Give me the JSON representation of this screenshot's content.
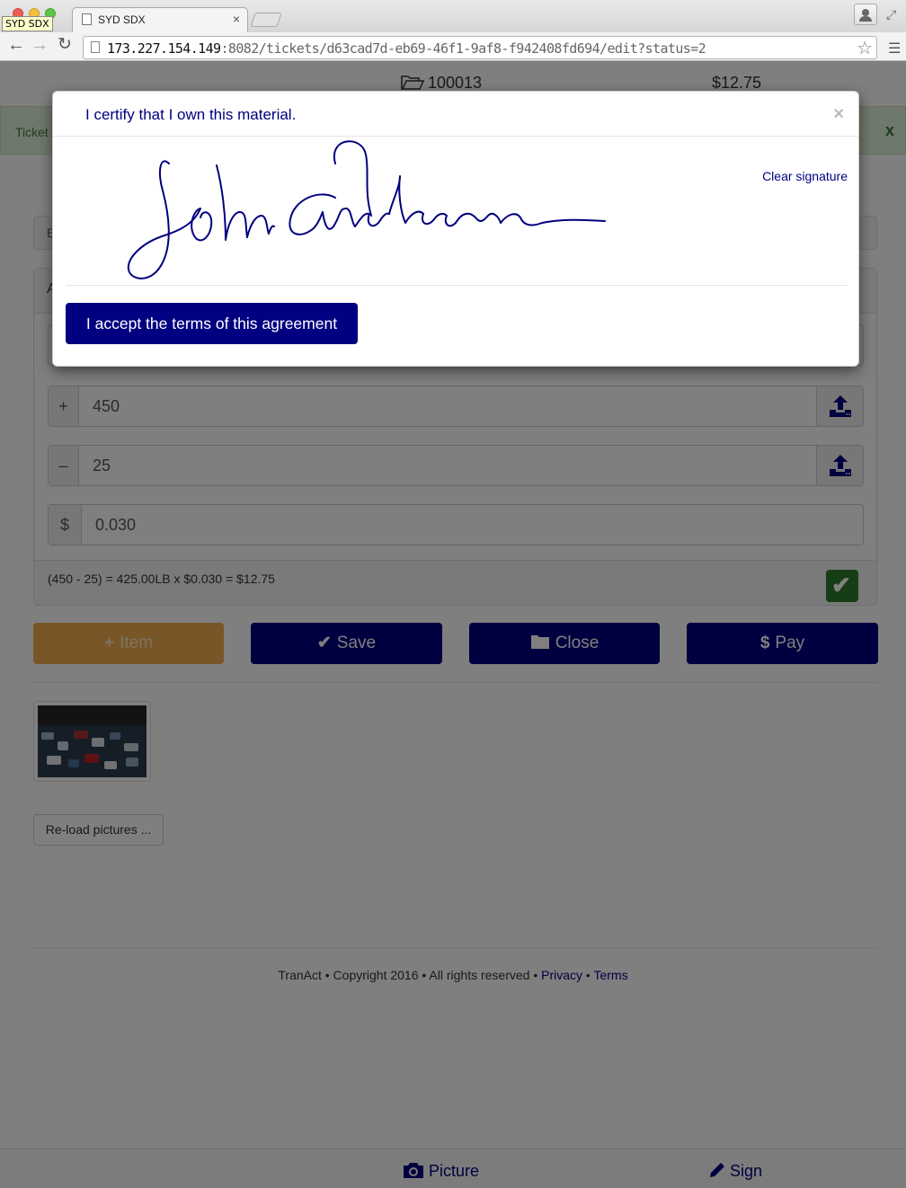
{
  "browser": {
    "tooltip": "SYD SDX",
    "tab_title": "SYD SDX",
    "tab_close": "×",
    "url_host": "173.227.154.149",
    "url_rest": ":8082/tickets/d63cad7d-eb69-46f1-9af8-f942408fd694/edit?status=2",
    "icons": {
      "back": "arrow-left-icon",
      "forward": "arrow-right-icon",
      "reload": "reload-icon",
      "bookmark": "star-icon",
      "menu": "hamburger-menu-icon"
    }
  },
  "ticket": {
    "number": "100013",
    "total": "$12.75",
    "alert_text": "Ticket",
    "alert_close": "x",
    "panel_label": "E",
    "section_label": "A"
  },
  "line_item": {
    "gross_sign": "+",
    "gross": "450",
    "tare_sign": "–",
    "tare": "25",
    "price_sign": "$",
    "price": "0.030",
    "calculation": "(450 - 25) = 425.00LB x $0.030 = $12.75"
  },
  "actions": {
    "item": "Item",
    "save": "Save",
    "close": "Close",
    "pay": "Pay"
  },
  "reload_pictures": "Re-load pictures ...",
  "footer": {
    "prefix": "TranAct • Copyright 2016 • All rights reserved • ",
    "privacy": "Privacy",
    "sep": " • ",
    "terms": "Terms"
  },
  "bottom_nav": {
    "picture": "Picture",
    "sign": "Sign"
  },
  "modal": {
    "title": "I certify that I own this material.",
    "close": "×",
    "clear_signature": "Clear signature",
    "accept_button": "I accept the terms of this agreement"
  },
  "colors": {
    "brand": "#000080",
    "warning": "#f0ad4e",
    "success": "#3c763d"
  }
}
